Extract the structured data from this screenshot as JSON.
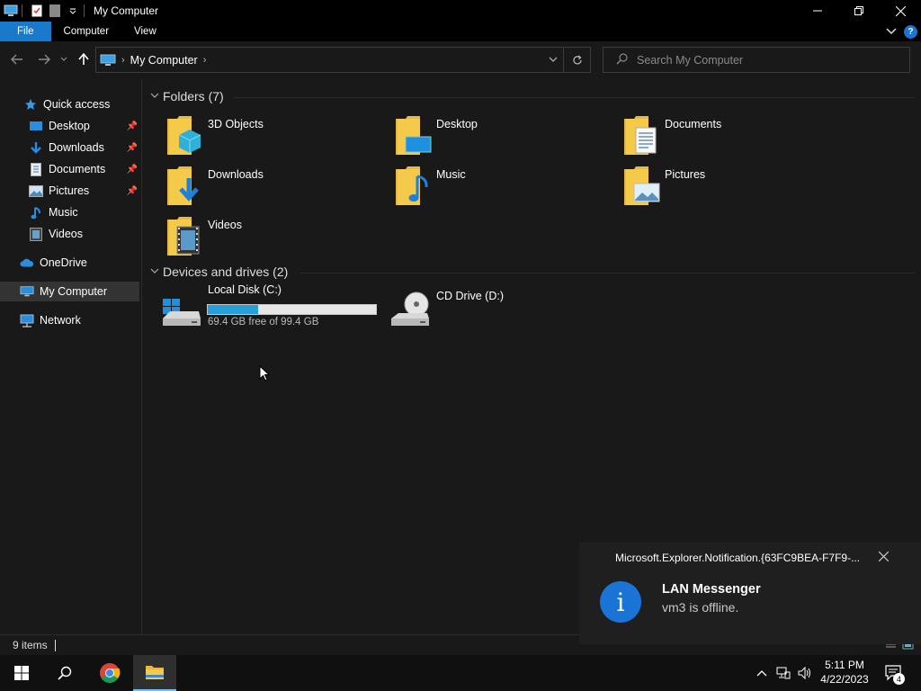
{
  "window": {
    "title": "My Computer"
  },
  "ribbon": {
    "tabs": [
      "File",
      "Computer",
      "View"
    ]
  },
  "address": {
    "crumb": "My Computer"
  },
  "search": {
    "placeholder": "Search My Computer"
  },
  "sidebar": {
    "items": [
      {
        "label": "Quick access",
        "icon": "star-icon"
      },
      {
        "label": "Desktop",
        "icon": "desktop-icon",
        "pinned": true
      },
      {
        "label": "Downloads",
        "icon": "download-icon",
        "pinned": true
      },
      {
        "label": "Documents",
        "icon": "document-icon",
        "pinned": true
      },
      {
        "label": "Pictures",
        "icon": "picture-icon",
        "pinned": true
      },
      {
        "label": "Music",
        "icon": "music-icon"
      },
      {
        "label": "Videos",
        "icon": "video-icon"
      },
      {
        "label": "OneDrive",
        "icon": "cloud-icon"
      },
      {
        "label": "My Computer",
        "icon": "computer-icon",
        "selected": true
      },
      {
        "label": "Network",
        "icon": "network-icon"
      }
    ]
  },
  "groups": {
    "folders_header": "Folders (7)",
    "drives_header": "Devices and drives (2)"
  },
  "folders": [
    {
      "name": "3D Objects"
    },
    {
      "name": "Desktop"
    },
    {
      "name": "Documents"
    },
    {
      "name": "Downloads"
    },
    {
      "name": "Music"
    },
    {
      "name": "Pictures"
    },
    {
      "name": "Videos"
    }
  ],
  "drives": [
    {
      "name": "Local Disk (C:)",
      "free_text": "69.4 GB free of 99.4 GB",
      "used_fraction": 0.3
    },
    {
      "name": "CD Drive (D:)"
    }
  ],
  "status": {
    "count": "9 items"
  },
  "toast": {
    "app": "Microsoft.Explorer.Notification.{63FC9BEA-F7F9-...",
    "title": "LAN Messenger",
    "message": "vm3 is offline."
  },
  "clock": {
    "time": "5:11 PM",
    "date": "4/22/2023"
  },
  "notifications": {
    "count": "4"
  },
  "colors": {
    "accent": "#1979ca",
    "drive_fill": "#26a0da",
    "folder": "#f5c94a"
  }
}
